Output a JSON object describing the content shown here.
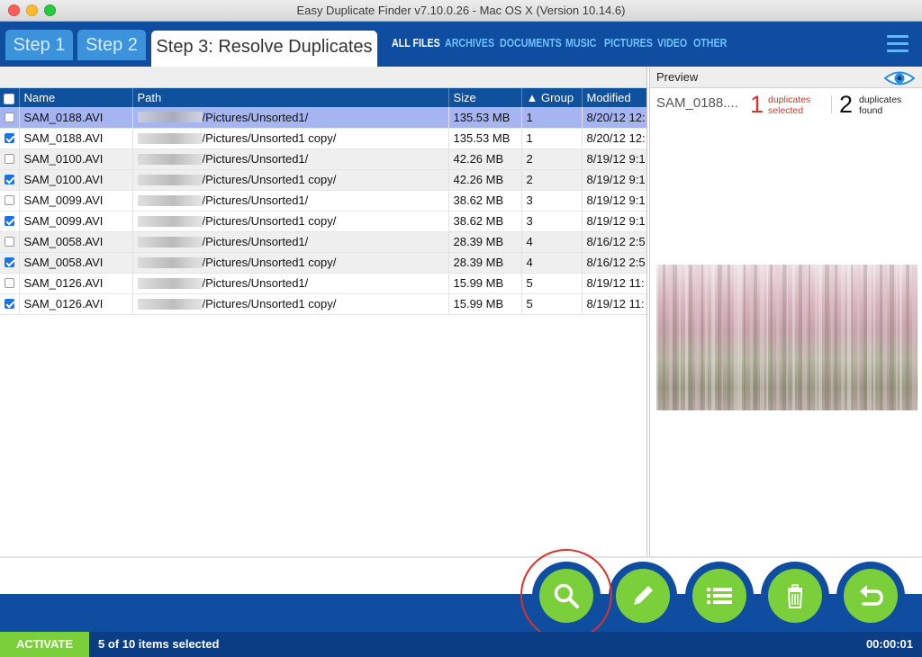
{
  "window": {
    "title": "Easy Duplicate Finder v7.10.0.26 - Mac OS X (Version 10.14.6)"
  },
  "steps": [
    {
      "label": "Step 1"
    },
    {
      "label": "Step 2"
    },
    {
      "label": "Step 3: Resolve Duplicates"
    }
  ],
  "filters": [
    "ALL FILES",
    "ARCHIVES",
    "DOCUMENTS",
    "MUSIC",
    "PICTURES",
    "VIDEO",
    "OTHER"
  ],
  "table": {
    "headers": {
      "name": "Name",
      "path": "Path",
      "size": "Size",
      "group": "▲ Group",
      "modified": "Modified"
    },
    "rows": [
      {
        "checked": false,
        "name": "SAM_0188.AVI",
        "path": "/Pictures/Unsorted1/",
        "size": "135.53 MB",
        "group": "1",
        "modified": "8/20/12 12:"
      },
      {
        "checked": true,
        "name": "SAM_0188.AVI",
        "path": "/Pictures/Unsorted1 copy/",
        "size": "135.53 MB",
        "group": "1",
        "modified": "8/20/12 12:"
      },
      {
        "checked": false,
        "name": "SAM_0100.AVI",
        "path": "/Pictures/Unsorted1/",
        "size": "42.26 MB",
        "group": "2",
        "modified": "8/19/12 9:1"
      },
      {
        "checked": true,
        "name": "SAM_0100.AVI",
        "path": "/Pictures/Unsorted1 copy/",
        "size": "42.26 MB",
        "group": "2",
        "modified": "8/19/12 9:1"
      },
      {
        "checked": false,
        "name": "SAM_0099.AVI",
        "path": "/Pictures/Unsorted1/",
        "size": "38.62 MB",
        "group": "3",
        "modified": "8/19/12 9:1"
      },
      {
        "checked": true,
        "name": "SAM_0099.AVI",
        "path": "/Pictures/Unsorted1 copy/",
        "size": "38.62 MB",
        "group": "3",
        "modified": "8/19/12 9:1"
      },
      {
        "checked": false,
        "name": "SAM_0058.AVI",
        "path": "/Pictures/Unsorted1/",
        "size": "28.39 MB",
        "group": "4",
        "modified": "8/16/12 2:5"
      },
      {
        "checked": true,
        "name": "SAM_0058.AVI",
        "path": "/Pictures/Unsorted1 copy/",
        "size": "28.39 MB",
        "group": "4",
        "modified": "8/16/12 2:5"
      },
      {
        "checked": false,
        "name": "SAM_0126.AVI",
        "path": "/Pictures/Unsorted1/",
        "size": "15.99 MB",
        "group": "5",
        "modified": "8/19/12 11:"
      },
      {
        "checked": true,
        "name": "SAM_0126.AVI",
        "path": "/Pictures/Unsorted1 copy/",
        "size": "15.99 MB",
        "group": "5",
        "modified": "8/19/12 11:"
      }
    ]
  },
  "preview": {
    "label": "Preview",
    "filename": "SAM_0188....",
    "selected_count": "1",
    "selected_label_1": "duplicates",
    "selected_label_2": "selected",
    "found_count": "2",
    "found_label_1": "duplicates",
    "found_label_2": "found"
  },
  "actions": [
    {
      "icon": "search-icon"
    },
    {
      "icon": "pencil-icon"
    },
    {
      "icon": "list-icon"
    },
    {
      "icon": "trash-icon"
    },
    {
      "icon": "undo-icon"
    }
  ],
  "status": {
    "activate_label": "ACTIVATE",
    "selection_text": "5 of 10 items selected",
    "timer": "00:00:01"
  },
  "colors": {
    "primary_blue": "#0f4da1",
    "tab_blue": "#3c93db",
    "action_green": "#7bcf3a",
    "selected_red": "#d9332c",
    "row_highlight": "#a6b4f2"
  }
}
